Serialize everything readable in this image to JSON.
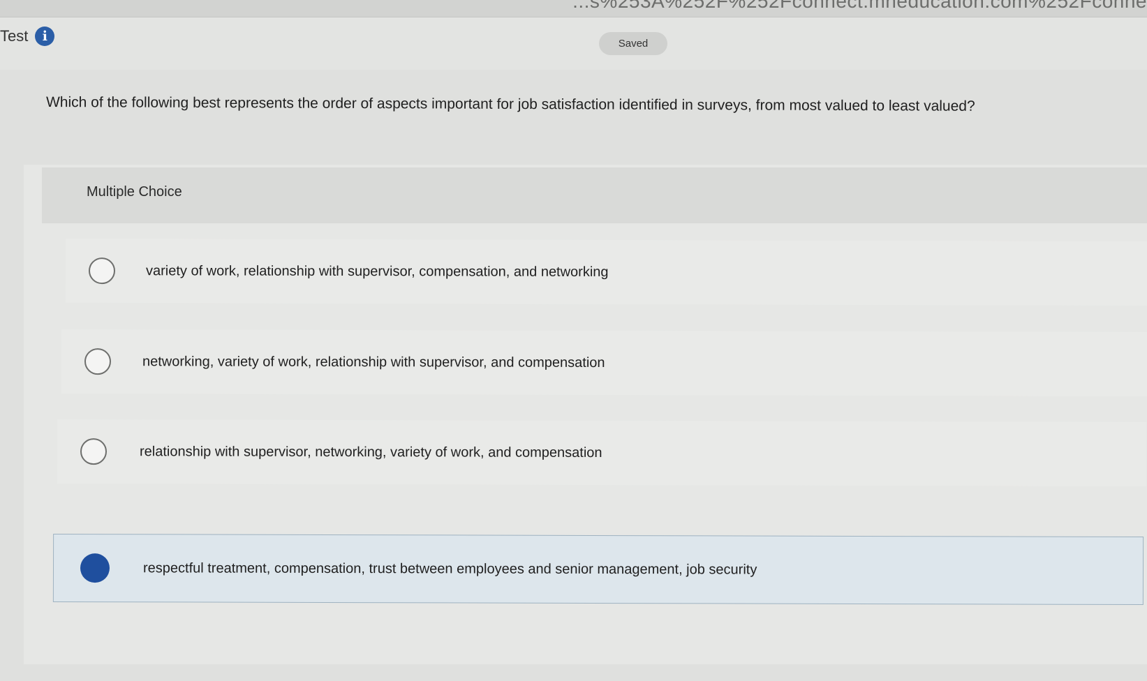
{
  "browser": {
    "url_fragment": "...s%253A%252F%252Fconnect.mheducation.com%252Fconne"
  },
  "header": {
    "title": "Test",
    "saved_label": "Saved"
  },
  "question": {
    "text": "Which of the following best represents the order of aspects important for job satisfaction identified in surveys, from most valued to least valued?"
  },
  "answer_section": {
    "type_label": "Multiple Choice",
    "choices": [
      {
        "label": "variety of work, relationship with supervisor, compensation, and networking",
        "selected": false
      },
      {
        "label": "networking, variety of work, relationship with supervisor, and compensation",
        "selected": false
      },
      {
        "label": "relationship with supervisor, networking, variety of work, and compensation",
        "selected": false
      },
      {
        "label": "respectful treatment, compensation, trust between employees and senior management, job security",
        "selected": true
      }
    ]
  },
  "colors": {
    "accent": "#1f4f9e",
    "info_icon": "#2b5ea7",
    "selected_background": "#dde6ec"
  },
  "icons": {
    "info": "info-icon",
    "radio_unselected": "radio-empty-icon",
    "radio_selected": "radio-filled-icon"
  }
}
